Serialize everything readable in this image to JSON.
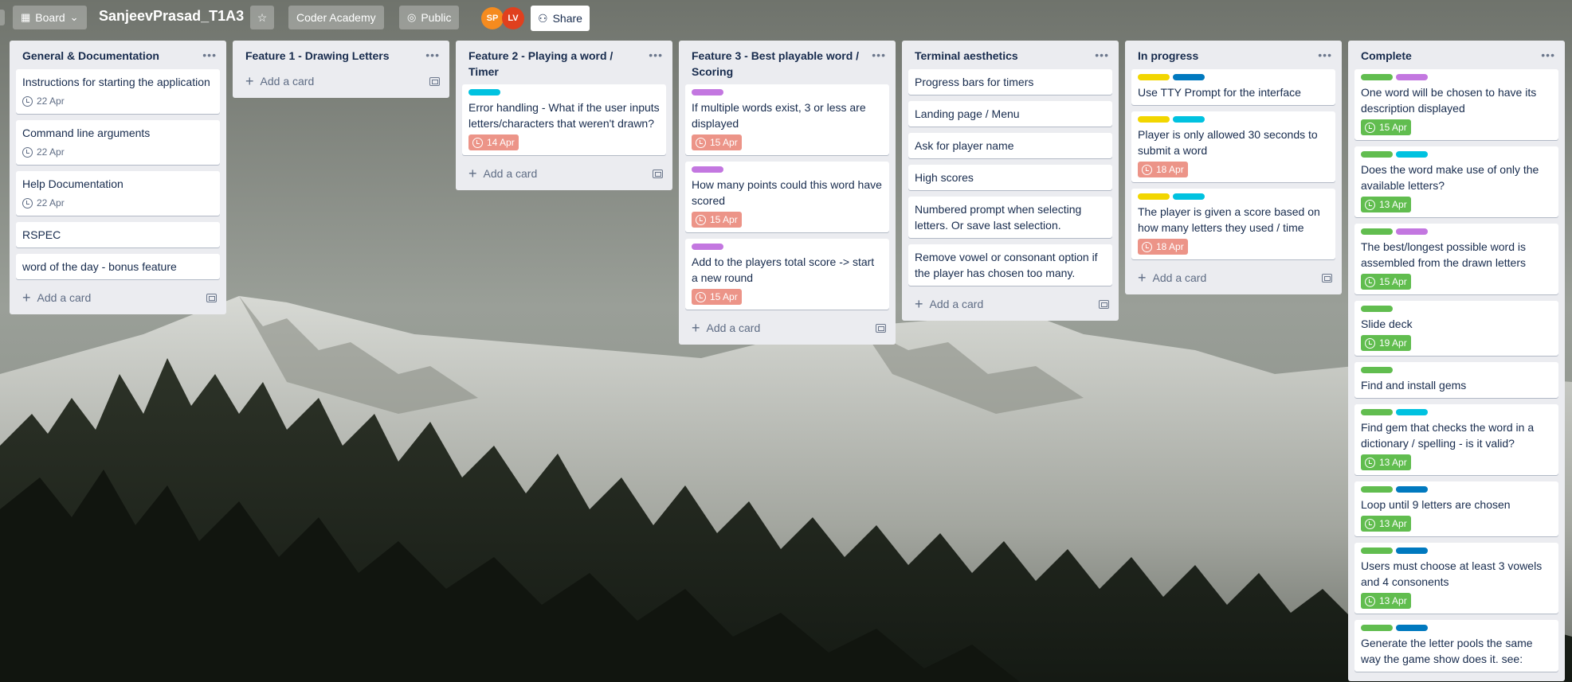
{
  "header": {
    "board_view_label": "Board",
    "board_title": "SanjeevPrasad_T1A3",
    "workspace_label": "Coder Academy",
    "visibility_label": "Public",
    "share_label": "Share",
    "members": [
      {
        "initials": "SP",
        "color": "#f58b1f"
      },
      {
        "initials": "LV",
        "color": "#e0401e"
      }
    ]
  },
  "add_card_label": "Add a card",
  "label_colors": {
    "green": "#61bd4f",
    "purple": "#c377e0",
    "sky": "#00c2e0",
    "blue": "#0079bf",
    "yellow": "#f2d600"
  },
  "lists": [
    {
      "title": "General & Documentation",
      "cards": [
        {
          "title": "Instructions for starting the application",
          "due": "22 Apr",
          "due_style": "plain",
          "labels": []
        },
        {
          "title": "Command line arguments",
          "due": "22 Apr",
          "due_style": "plain",
          "labels": []
        },
        {
          "title": "Help Documentation",
          "due": "22 Apr",
          "due_style": "plain",
          "labels": []
        },
        {
          "title": "RSPEC",
          "labels": []
        },
        {
          "title": "word of the day - bonus feature",
          "labels": []
        }
      ]
    },
    {
      "title": "Feature 1 - Drawing Letters",
      "cards": []
    },
    {
      "title": "Feature 2 - Playing a word / Timer",
      "cards": [
        {
          "title": "Error handling - What if the user inputs letters/characters that weren't drawn?",
          "due": "14 Apr",
          "due_style": "overdue",
          "labels": [
            "sky"
          ]
        }
      ]
    },
    {
      "title": "Feature 3 - Best playable word / Scoring",
      "cards": [
        {
          "title": "If multiple words exist, 3 or less are displayed",
          "due": "15 Apr",
          "due_style": "overdue",
          "labels": [
            "purple"
          ]
        },
        {
          "title": "How many points could this word have scored",
          "due": "15 Apr",
          "due_style": "overdue",
          "labels": [
            "purple"
          ]
        },
        {
          "title": "Add to the players total score -> start a new round",
          "due": "15 Apr",
          "due_style": "overdue",
          "labels": [
            "purple"
          ]
        }
      ]
    },
    {
      "title": "Terminal aesthetics",
      "cards": [
        {
          "title": "Progress bars for timers",
          "labels": []
        },
        {
          "title": "Landing page / Menu",
          "labels": []
        },
        {
          "title": "Ask for player name",
          "labels": []
        },
        {
          "title": "High scores",
          "labels": []
        },
        {
          "title": "Numbered prompt when selecting letters. Or save last selection.",
          "labels": []
        },
        {
          "title": "Remove vowel or consonant option if the player has chosen too many.",
          "labels": []
        }
      ]
    },
    {
      "title": "In progress",
      "cards": [
        {
          "title": "Use TTY Prompt for the interface",
          "labels": [
            "yellow",
            "blue"
          ]
        },
        {
          "title": "Player is only allowed 30 seconds to submit a word",
          "due": "18 Apr",
          "due_style": "overdue",
          "labels": [
            "yellow",
            "sky"
          ]
        },
        {
          "title": "The player is given a score based on how many letters they used / time",
          "due": "18 Apr",
          "due_style": "overdue",
          "labels": [
            "yellow",
            "sky"
          ]
        }
      ]
    },
    {
      "title": "Complete",
      "cards": [
        {
          "title": "One word will be chosen to have its description displayed",
          "due": "15 Apr",
          "due_style": "complete",
          "labels": [
            "green",
            "purple"
          ]
        },
        {
          "title": "Does the word make use of only the available letters?",
          "due": "13 Apr",
          "due_style": "complete",
          "labels": [
            "green",
            "sky"
          ]
        },
        {
          "title": "The best/longest possible word is assembled from the drawn letters",
          "due": "15 Apr",
          "due_style": "complete",
          "labels": [
            "green",
            "purple"
          ]
        },
        {
          "title": "Slide deck",
          "due": "19 Apr",
          "due_style": "complete",
          "labels": [
            "green"
          ]
        },
        {
          "title": "Find and install gems",
          "labels": [
            "green"
          ]
        },
        {
          "title": "Find gem that checks the word in a dictionary / spelling - is it valid?",
          "due": "13 Apr",
          "due_style": "complete",
          "labels": [
            "green",
            "sky"
          ]
        },
        {
          "title": "Loop until 9 letters are chosen",
          "due": "13 Apr",
          "due_style": "complete",
          "labels": [
            "green",
            "blue"
          ]
        },
        {
          "title": "Users must choose at least 3 vowels and 4 consonents",
          "due": "13 Apr",
          "due_style": "complete",
          "labels": [
            "green",
            "blue"
          ]
        },
        {
          "title": "Generate the letter pools the same way the game show does it. see:",
          "labels": [
            "green",
            "blue"
          ]
        }
      ]
    }
  ]
}
